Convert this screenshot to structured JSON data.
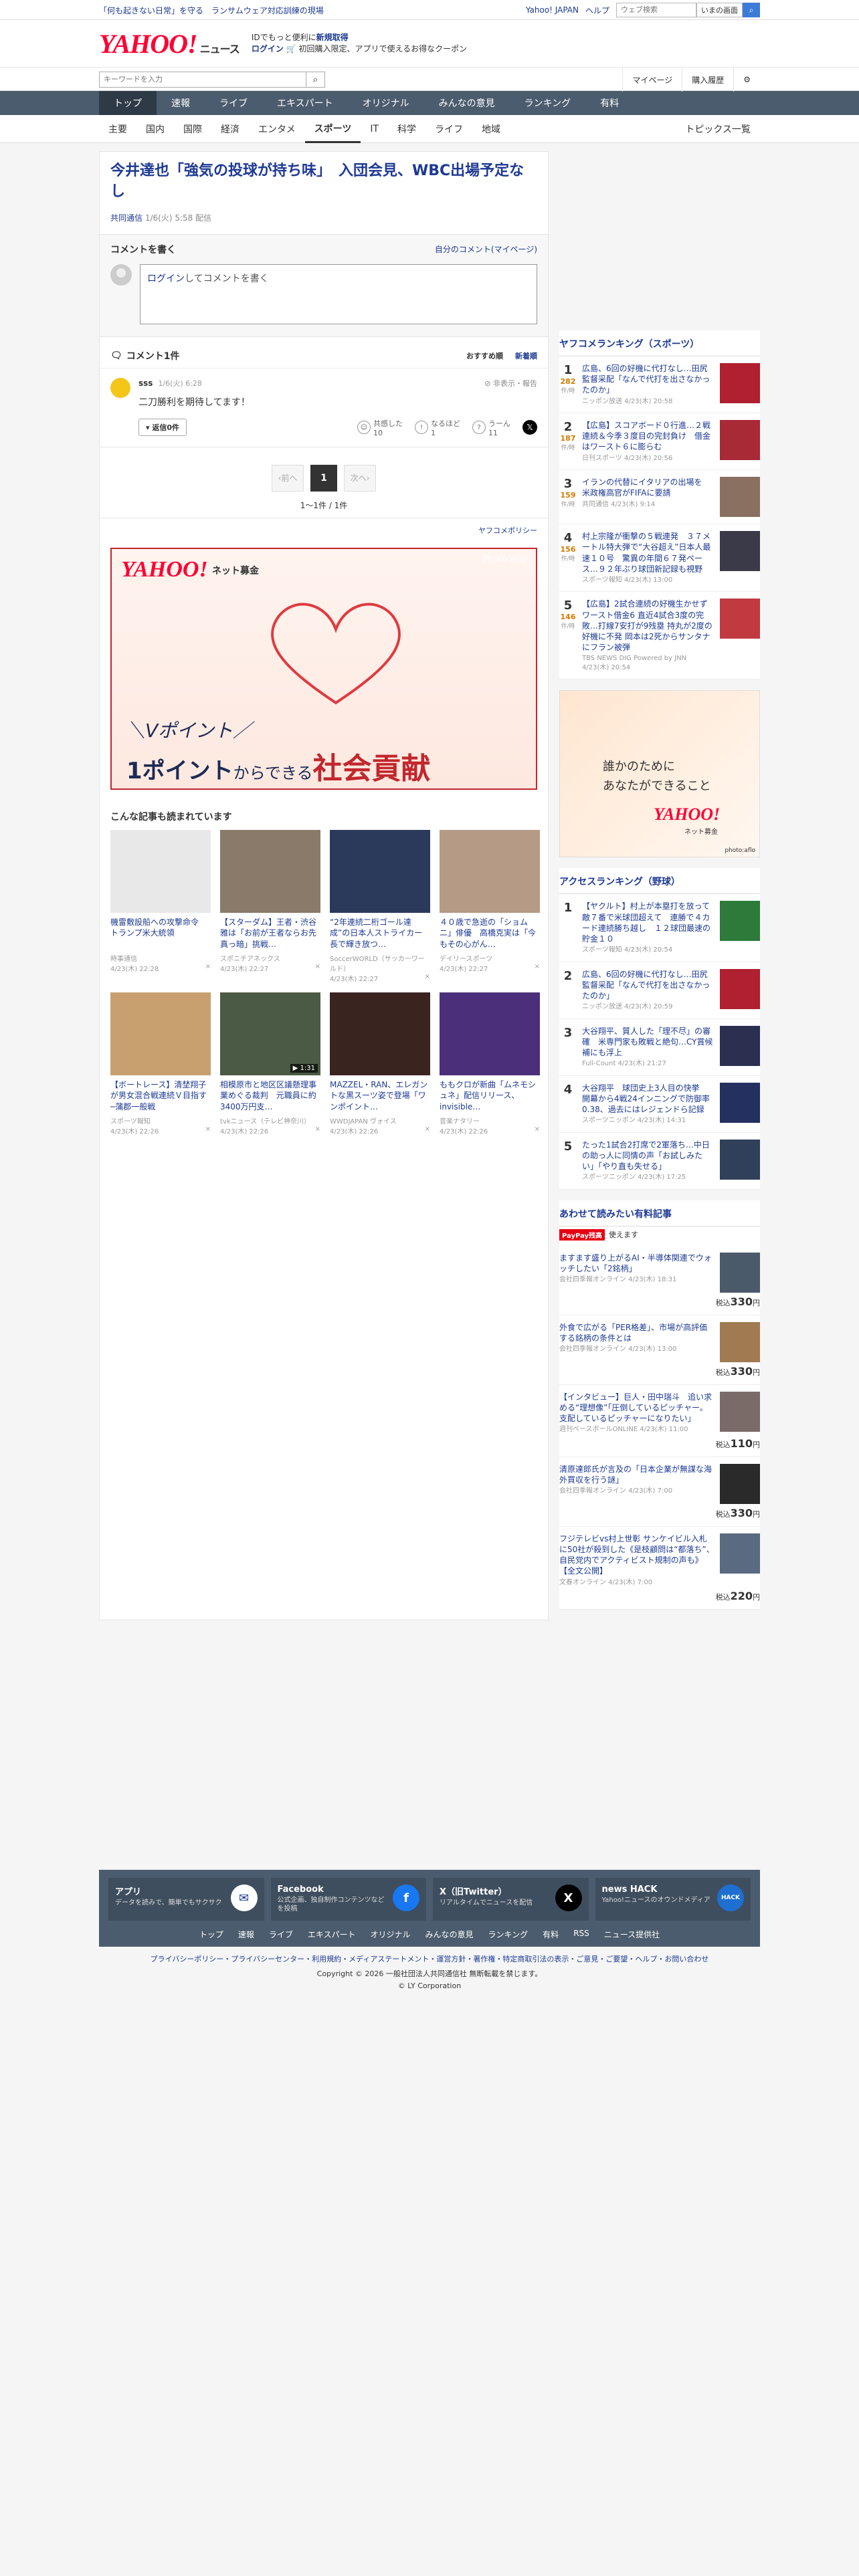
{
  "topbar": {
    "notice": "「何も起きない日常」を守る　ランサムウェア対応訓練の現場",
    "links": [
      "Yahoo! JAPAN",
      "ヘルプ"
    ],
    "search_placeholder": "ウェブ検索",
    "search_option": "いまの画面"
  },
  "header": {
    "logo": "YAHOO!",
    "logo_sub": "ニュース",
    "promo_line1_pre": "IDでもっと便利に",
    "promo_line1_link": "新規取得",
    "promo_line2_link": "ログイン",
    "promo_line2_rest": "初回購入限定、アプリで使えるお得なクーポン"
  },
  "searchrow": {
    "placeholder": "キーワードを入力",
    "mypage": "マイページ",
    "history": "購入履歴"
  },
  "mainnav": [
    "トップ",
    "速報",
    "ライブ",
    "エキスパート",
    "オリジナル",
    "みんなの意見",
    "ランキング",
    "有料"
  ],
  "subnav": [
    "主要",
    "国内",
    "国際",
    "経済",
    "エンタメ",
    "スポーツ",
    "IT",
    "科学",
    "ライフ",
    "地域"
  ],
  "subnav_right": "トピックス一覧",
  "article": {
    "headline": "今井達也「強気の投球が持ち味」　入団会見、WBC出場予定なし",
    "source": "共同通信",
    "date": "1/6(火) 5:58 配信"
  },
  "comment_box": {
    "title": "コメントを書く",
    "mine": "自分のコメント(マイページ)",
    "login": "ログイン",
    "prompt": "してコメントを書く"
  },
  "comments_section": {
    "title": "コメント1件",
    "sort_recommended": "おすすめ順",
    "sort_new": "新着順",
    "items": [
      {
        "name": "sss",
        "time": "1/6(火) 6:28",
        "report": "非表示・報告",
        "text": "二刀勝利を期待してます！",
        "reply": "返信0件",
        "react1_label": "共感した",
        "react1_count": "10",
        "react2_label": "なるほど",
        "react2_count": "1",
        "react3_label": "うーん",
        "react3_count": "11"
      }
    ]
  },
  "pager": {
    "prev": "前へ",
    "current": "1",
    "next": "次へ",
    "count": "1〜1件 / 1件"
  },
  "policy": "ヤフコメポリシー",
  "banner": {
    "logo": "YAHOO!",
    "sub": "ネット募金",
    "photo": "Photo:aflo",
    "line1": "＼Vポイント／",
    "line2_a": "1ポイント",
    "line2_b": "からできる",
    "line2_c": "社会貢献"
  },
  "recommend": {
    "title": "こんな記事も読まれています",
    "items": [
      {
        "title": "機雷敷設船への攻撃命令　トランプ米大統領",
        "source": "時事通信",
        "time": "4/23(木) 22:28",
        "color": "#e8e8e8",
        "video": ""
      },
      {
        "title": "【スターダム】王者・渋谷雅は「お前が王者ならお先真っ暗」挑戦…",
        "source": "スポニチアネックス",
        "time": "4/23(木) 22:27",
        "color": "#8a7a6a",
        "video": ""
      },
      {
        "title": "“2年連続二桁ゴール達成”の日本人ストライカー　長で輝き放つ…",
        "source": "SoccerWORLD（サッカーワールド）",
        "time": "4/23(木) 22:27",
        "color": "#2b3a5a",
        "video": ""
      },
      {
        "title": "４０歳で急逝の「ショムニ」俳優　高橋克実は「今もその心がん…",
        "source": "デイリースポーツ",
        "time": "4/23(木) 22:27",
        "color": "#b59a86",
        "video": ""
      },
      {
        "title": "【ボートレース】清埜翔子が男女混合戦連続Ｖ目指す─蒲郡一般戦",
        "source": "スポーツ報知",
        "time": "4/23(木) 22:26",
        "color": "#c8a070",
        "video": ""
      },
      {
        "title": "相模原市と地区区議懸理事業めぐる裁判　元職員に約3400万円支…",
        "source": "tvkニュース（テレビ神奈川）",
        "time": "4/23(木) 22:26",
        "color": "#4a5a44",
        "video": "▶ 1:31"
      },
      {
        "title": "MAZZEL・RAN、エレガントな黒スーツ姿で登場「ワンポイント…",
        "source": "WWDJAPAN ヴォイス",
        "time": "4/23(木) 22:26",
        "color": "#3a2420",
        "video": ""
      },
      {
        "title": "ももクロが新曲「ムネモシュネ」配信リリース、invisible…",
        "source": "音楽ナタリー",
        "time": "4/23(木) 22:26",
        "color": "#4b2f7a",
        "video": ""
      }
    ]
  },
  "sidebar": {
    "ranking_title": "ヤフコメランキング（スポーツ）",
    "ranking": [
      {
        "num": "1",
        "count": "282",
        "unit": "件/時",
        "title": "広島、6回の好機に代打なし…田尻監督采配「なんで代打を出さなかったのか」",
        "meta": "ニッポン放送 4/23(木) 20:58",
        "color": "#b02030"
      },
      {
        "num": "2",
        "count": "187",
        "unit": "件/時",
        "title": "【広島】スコアボード０行進…２戦連続＆今季３度目の完封負け　借金はワースト６に膨らむ",
        "meta": "日刊スポーツ 4/23(木) 20:56",
        "color": "#a82a36"
      },
      {
        "num": "3",
        "count": "159",
        "unit": "件/時",
        "title": "イランの代替にイタリアの出場を　米政権高官がFIFAに要請",
        "meta": "共同通信 4/23(木) 9:14",
        "color": "#8a7060"
      },
      {
        "num": "4",
        "count": "156",
        "unit": "件/時",
        "title": "村上宗隆が衝撃の５戦連発　３７メートル特大弾で“大谷超え”日本人最速１０号　驚異の年間６７発ペース…９２年ぶり球団新記録も視野",
        "meta": "スポーツ報知 4/23(木) 13:00",
        "color": "#3a3a48"
      },
      {
        "num": "5",
        "count": "146",
        "unit": "件/時",
        "title": "【広島】2試合連続の好機生かせずワースト借金6 直近4試合3度の完敗…打線7安打が9残塁 持丸が2度の好機に不発 岡本は2死からサンタナにフラン被弾",
        "meta": "TBS NEWS DIG Powered by JNN 4/23(木) 20:54",
        "color": "#c03a40"
      }
    ],
    "ad_line1": "誰かのために",
    "ad_line2": "あなたができること",
    "ad_logo": "YAHOO!",
    "ad_sub": "ネット募金",
    "ad_credit": "photo:aflo",
    "access_title": "アクセスランキング（野球）",
    "access": [
      {
        "num": "1",
        "title": "【ヤクルト】村上が本塁打を放って敵７番で米球団超えて　連勝で４カード連続勝ち越し　１２球団最速の貯金１０",
        "meta": "スポーツ報知 4/23(木) 20:54",
        "color": "#2d7a3a"
      },
      {
        "num": "2",
        "title": "広島、6回の好機に代打なし…田尻監督采配「なんで代打を出さなかったのか」",
        "meta": "ニッポン放送 4/23(木) 20:59",
        "color": "#b02030"
      },
      {
        "num": "3",
        "title": "大谷翔平、質人した「理不尽」の審確　米専門家も敗戦と絶句…CY賞候補にも浮上",
        "meta": "Full-Count 4/23(木) 21:27",
        "color": "#2b3050"
      },
      {
        "num": "4",
        "title": "大谷翔平　球団史上3人目の快挙　開幕から4戦24インニングで防御率0.38、過去にはレジェンドら記録",
        "meta": "スポーツニッポン 4/23(木) 14:31",
        "color": "#243060"
      },
      {
        "num": "5",
        "title": "たった1試合2打席で2軍落ち…中日の助っ人に同情の声「お試しみたい」「やり直も失せる」",
        "meta": "スポーツニッポン 4/23(木) 17:25",
        "color": "#30405a"
      }
    ],
    "paid_title": "あわせて読みたい有料記事",
    "paypay_badge": "PayPay残高",
    "paypay_text": "使えます",
    "price_prefix": "税込",
    "price_suffix": "円",
    "paid": [
      {
        "title": "ますます盛り上がるAI・半導体関連でウォッチしたい「2銘柄」",
        "meta": "会社四季報オンライン 4/23(木) 18:31",
        "price": "330",
        "color": "#4a5a6a"
      },
      {
        "title": "外食で広がる「PER格差」、市場が高評価する銘柄の条件とは",
        "meta": "会社四季報オンライン 4/23(木) 13:00",
        "price": "330",
        "color": "#a07a50"
      },
      {
        "title": "【インタビュー】巨人・田中瑞斗　追い求める“理想像”「圧倒しているピッチャー。支配しているピッチャーになりたい」",
        "meta": "週刊ベースボールONLINE 4/23(木) 11:00",
        "price": "110",
        "color": "#7a6a68"
      },
      {
        "title": "清原達郎氏が言及の「日本企業が無謀な海外買収を行う謎」",
        "meta": "会社四季報オンライン 4/23(木) 7:00",
        "price": "330",
        "color": "#2a2a2a"
      },
      {
        "title": "フジテレビvs村上世彰 サンケイビル入札に50社が殺到した《是枝顧問は“都落ち”、自民党内でアクティビスト規制の声も》【全文公開】",
        "meta": "文春オンライン 4/23(木) 7:00",
        "price": "220",
        "color": "#5a6a80"
      }
    ]
  },
  "footer": {
    "apps": [
      {
        "title": "アプリ",
        "desc": "データを読みで、簡単でもサクサク",
        "icon": "✉",
        "color": "#ffffff",
        "fg": "#1d3994"
      },
      {
        "title": "Facebook",
        "desc": "公式企画、独自制作コンテンツなどを投稿",
        "icon": "f",
        "color": "#1877f2",
        "fg": "#ffffff"
      },
      {
        "title": "X（旧Twitter）",
        "desc": "リアルタイムでニュースを配信",
        "icon": "X",
        "color": "#000000",
        "fg": "#ffffff"
      },
      {
        "title": "news HACK",
        "desc": "Yahoo!ニュースのオウンドメディア",
        "icon": "HACK",
        "color": "#1d6fd0",
        "fg": "#ffffff"
      }
    ],
    "nav": [
      "トップ",
      "速報",
      "ライブ",
      "エキスパート",
      "オリジナル",
      "みんなの意見",
      "ランキング",
      "有料",
      "RSS",
      "ニュース提供社"
    ],
    "links": "プライバシーポリシー・プライバシーセンター・利用規約・メディアステートメント・運営方針・著作権・特定商取引法の表示・ご意見・ご要望・ヘルプ・お問い合わせ",
    "copyright": "Copyright © 2026 一般社団法人共同通信社 無断転載を禁じます。",
    "corp": "© LY Corporation"
  }
}
